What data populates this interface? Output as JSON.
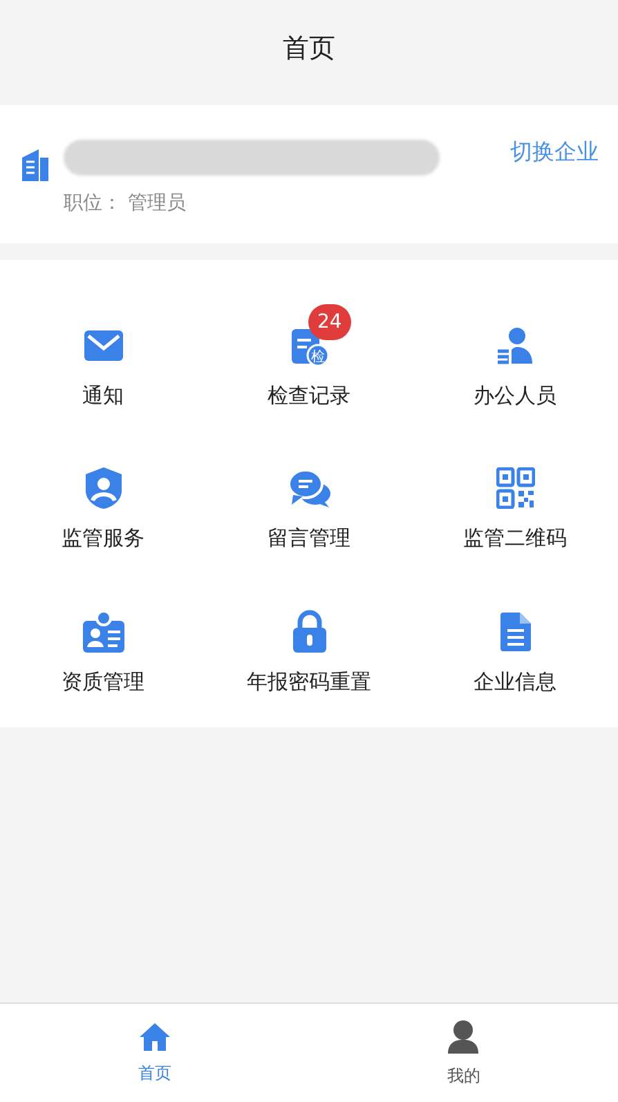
{
  "header": {
    "title": "首页"
  },
  "company": {
    "switch_label": "切换企业",
    "position": "职位： 管理员"
  },
  "menu_rows": [
    [
      {
        "label": "通知"
      },
      {
        "label": "检查记录",
        "badge": "24",
        "icon_text": "检"
      },
      {
        "label": "办公人员"
      }
    ],
    [
      {
        "label": "监管服务"
      },
      {
        "label": "留言管理"
      },
      {
        "label": "监管二维码"
      }
    ],
    [
      {
        "label": "资质管理"
      },
      {
        "label": "年报密码重置"
      },
      {
        "label": "企业信息"
      }
    ]
  ],
  "tabbar": [
    {
      "label": "首页",
      "selected": true
    },
    {
      "label": "我的",
      "selected": false
    }
  ]
}
